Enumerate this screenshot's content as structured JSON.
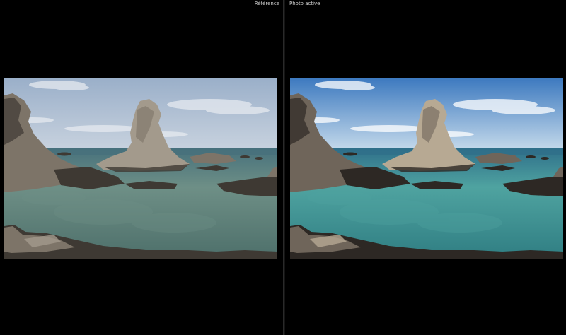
{
  "panels": [
    {
      "label": "Référence",
      "palette": {
        "sky_top": "#9aafc9",
        "sky_bottom": "#c9d3df",
        "sea": "#47717c",
        "water_near": "#4d6f6a",
        "water_mid": "#6e8f86",
        "rock": "#7d7468",
        "rock_light": "#a39a8c",
        "rock_dark": "#3e3933",
        "cloud": "#e6eaf0"
      }
    },
    {
      "label": "Photo active",
      "palette": {
        "sky_top": "#3c79bf",
        "sky_bottom": "#c8dcec",
        "sea": "#2f6f8a",
        "water_near": "#2f7d82",
        "water_mid": "#4fa3a0",
        "rock": "#6f655a",
        "rock_light": "#b7a993",
        "rock_dark": "#2d2824",
        "cloud": "#ffffff"
      }
    }
  ]
}
